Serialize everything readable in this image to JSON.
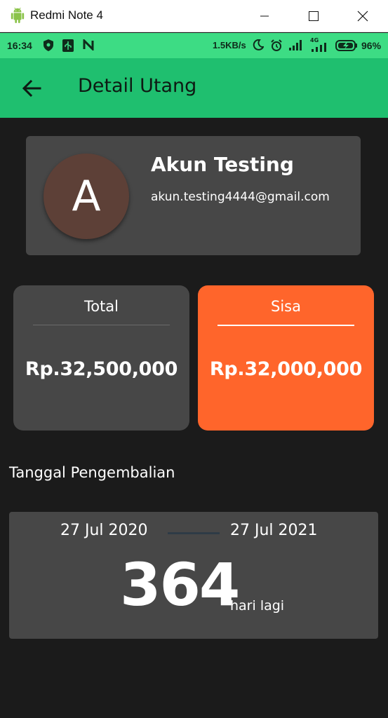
{
  "window": {
    "title": "Redmi Note 4"
  },
  "status_bar": {
    "time": "16:34",
    "network_speed": "1.5KB/s",
    "network_type": "4G",
    "battery": "96%"
  },
  "app_bar": {
    "title": "Detail Utang"
  },
  "profile": {
    "avatar_initial": "A",
    "avatar_color": "#5d4037",
    "name": "Akun Testing",
    "email": "akun.testing4444@gmail.com"
  },
  "amounts": {
    "total_label": "Total",
    "total_value": "Rp.32,500,000",
    "remaining_label": "Sisa",
    "remaining_value": "Rp.32,000,000",
    "remaining_color": "#ff652b"
  },
  "return_date": {
    "section_title": "Tanggal Pengembalian",
    "start_date": "27 Jul 2020",
    "end_date": "27 Jul 2021",
    "days_remaining": "364",
    "days_label": "hari lagi"
  },
  "colors": {
    "primary": "#1fbf6f",
    "status_bar": "#3ddc84",
    "background": "#1b1b1b",
    "card": "#474747"
  }
}
